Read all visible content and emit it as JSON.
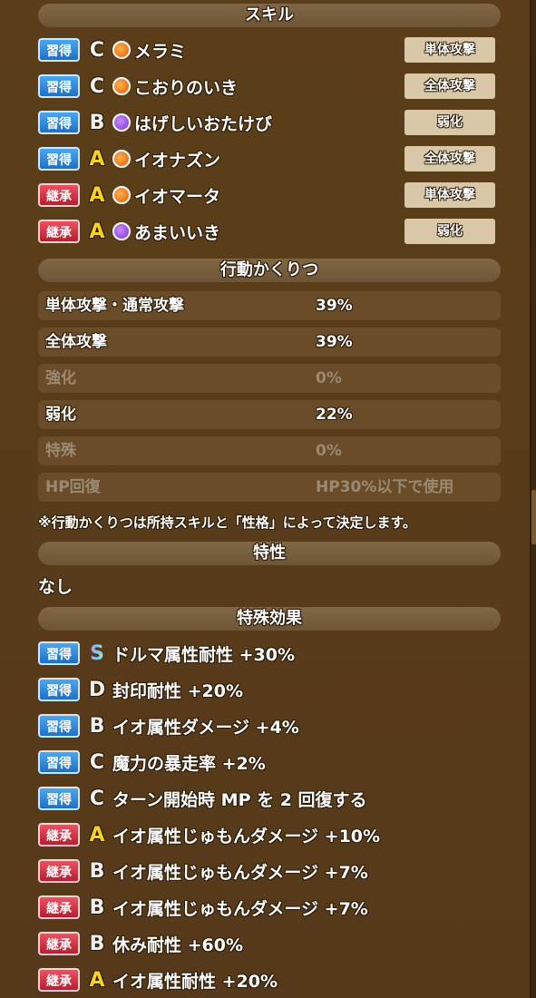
{
  "sections": {
    "skills": "スキル",
    "behavior": "行動かくりつ",
    "trait": "特性",
    "special": "特殊効果"
  },
  "badges": {
    "learn": "習得",
    "inherit": "継承"
  },
  "skills": [
    {
      "badge": "習得",
      "kind": "learn",
      "rank": "C",
      "icon": "fire-orb-icon",
      "name": "メラミ",
      "tag": "単体攻撃"
    },
    {
      "badge": "習得",
      "kind": "learn",
      "rank": "C",
      "icon": "fire-orb-icon",
      "name": "こおりのいき",
      "tag": "全体攻撃"
    },
    {
      "badge": "習得",
      "kind": "learn",
      "rank": "B",
      "icon": "debuff-orb-icon",
      "name": "はげしいおたけび",
      "tag": "弱化"
    },
    {
      "badge": "習得",
      "kind": "learn",
      "rank": "A",
      "icon": "fire-orb-icon",
      "name": "イオナズン",
      "tag": "全体攻撃"
    },
    {
      "badge": "継承",
      "kind": "inherit",
      "rank": "A",
      "icon": "fire-orb-icon",
      "name": "イオマータ",
      "tag": "単体攻撃"
    },
    {
      "badge": "継承",
      "kind": "inherit",
      "rank": "A",
      "icon": "debuff-orb-icon",
      "name": "あまいいき",
      "tag": "弱化"
    }
  ],
  "behavior": [
    {
      "label": "単体攻撃・通常攻撃",
      "value": "39%",
      "dim": false
    },
    {
      "label": "全体攻撃",
      "value": "39%",
      "dim": false
    },
    {
      "label": "強化",
      "value": "0%",
      "dim": true
    },
    {
      "label": "弱化",
      "value": "22%",
      "dim": false
    },
    {
      "label": "特殊",
      "value": "0%",
      "dim": true
    },
    {
      "label": "HP回復",
      "value": "HP30%以下で使用",
      "dim": true
    }
  ],
  "note": "※行動かくりつは所持スキルと「性格」によって決定します。",
  "trait_value": "なし",
  "effects": [
    {
      "badge": "習得",
      "kind": "learn",
      "rank": "S",
      "name": "ドルマ属性耐性 +30%"
    },
    {
      "badge": "習得",
      "kind": "learn",
      "rank": "D",
      "name": "封印耐性 +20%"
    },
    {
      "badge": "習得",
      "kind": "learn",
      "rank": "B",
      "name": "イオ属性ダメージ +4%"
    },
    {
      "badge": "習得",
      "kind": "learn",
      "rank": "C",
      "name": "魔力の暴走率 +2%"
    },
    {
      "badge": "習得",
      "kind": "learn",
      "rank": "C",
      "name": "ターン開始時 MP を 2 回復する"
    },
    {
      "badge": "継承",
      "kind": "inherit",
      "rank": "A",
      "name": "イオ属性じゅもんダメージ +10%"
    },
    {
      "badge": "継承",
      "kind": "inherit",
      "rank": "B",
      "name": "イオ属性じゅもんダメージ +7%"
    },
    {
      "badge": "継承",
      "kind": "inherit",
      "rank": "B",
      "name": "イオ属性じゅもんダメージ +7%"
    },
    {
      "badge": "継承",
      "kind": "inherit",
      "rank": "B",
      "name": "休み耐性 +60%"
    },
    {
      "badge": "継承",
      "kind": "inherit",
      "rank": "A",
      "name": "イオ属性耐性 +20%"
    }
  ],
  "colors": {
    "learn": "#1e6fc8",
    "inherit": "#b81e2e",
    "rank_a": "#f7d51d",
    "panel": "#5a3d18"
  }
}
